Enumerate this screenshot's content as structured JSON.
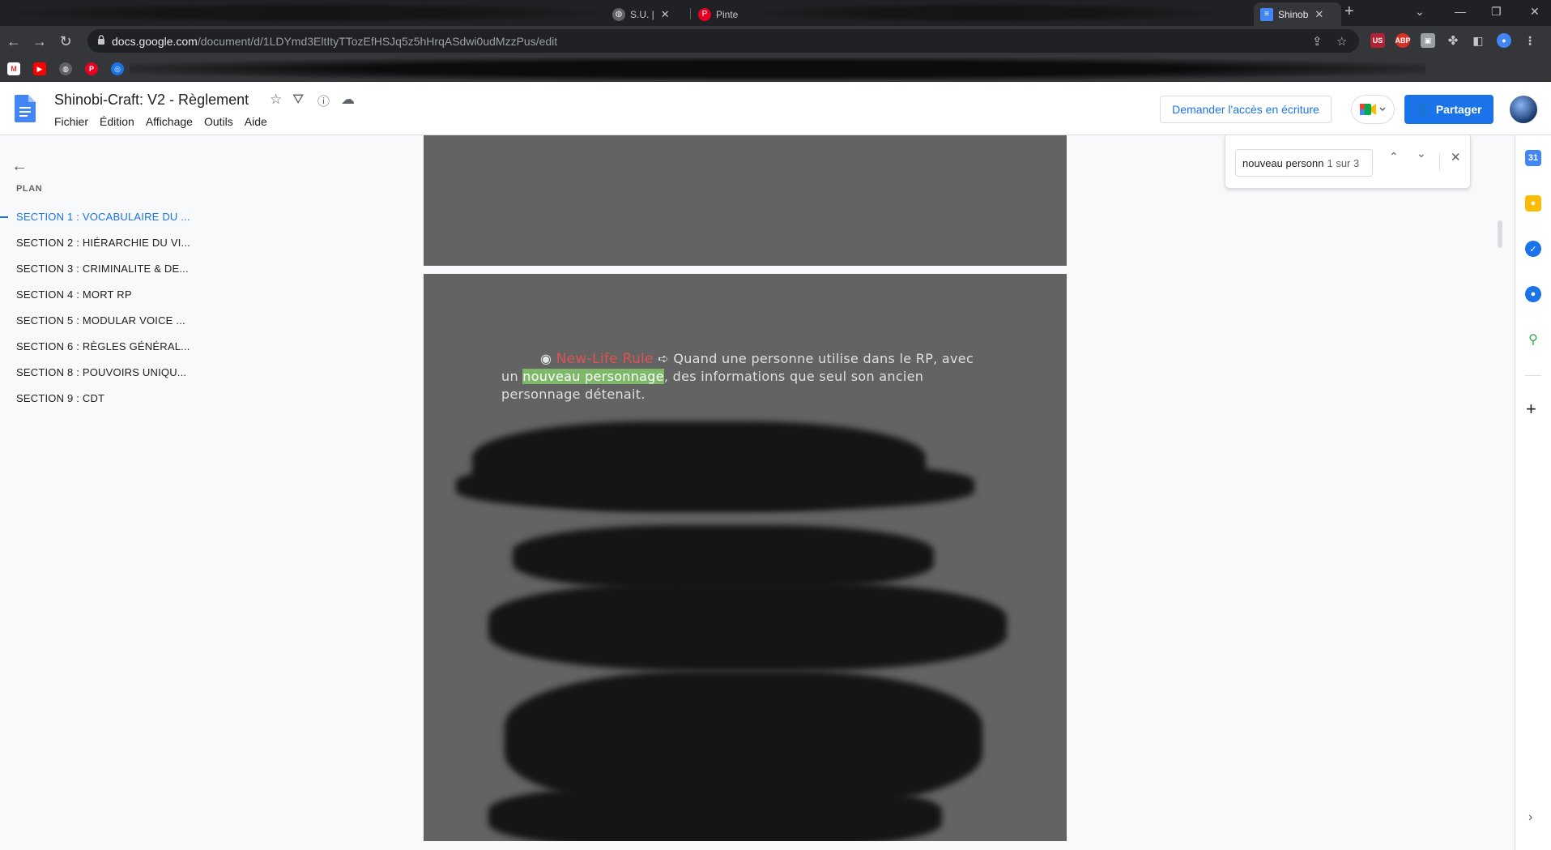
{
  "browser": {
    "tabs": [
      {
        "label": "S.U. |",
        "active": false
      },
      {
        "label": "Pinte",
        "active": false
      },
      {
        "label": "Shinob",
        "active": true
      }
    ],
    "new_tab": "+",
    "url_host": "docs.google.com",
    "url_path": "/document/d/1LDYmd3EltItyTTozEfHSJq5z5hHrqASdwi0udMzzPus/edit"
  },
  "doc": {
    "title": "Shinobi-Craft: V2 - Règlement",
    "menu": [
      "Fichier",
      "Édition",
      "Affichage",
      "Outils",
      "Aide"
    ],
    "request_access": "Demander l'accès en écriture",
    "share": "Partager"
  },
  "outline": {
    "label": "PLAN",
    "items": [
      "SECTION 1 : VOCABULAIRE DU ...",
      "SECTION 2 : HIÉRARCHIE DU VI...",
      "SECTION 3 : CRIMINALITE & DE...",
      "SECTION 4 : MORT RP",
      "SECTION 5 : MODULAR VOICE ...",
      "SECTION 6 : RÈGLES GÉNÉRAL...",
      "SECTION 8 : POUVOIRS UNIQU...",
      "SECTION 9 : CDT"
    ],
    "active_index": 0
  },
  "content": {
    "bullet": "◉",
    "rule_name": "New-Life Rule",
    "arrow": "➪",
    "text_before": " Quand une personne utilise dans le RP, avec un",
    "highlight": "nouveau personnage",
    "text_after": ", des informations que seul son ancien personnage détenait."
  },
  "find": {
    "query": "nouveau personn",
    "count": "1 sur 3"
  },
  "colors": {
    "accent": "#1a73e8",
    "page_bg": "#636363",
    "highlight": "#7eb96a",
    "rule_name": "#e05252"
  }
}
